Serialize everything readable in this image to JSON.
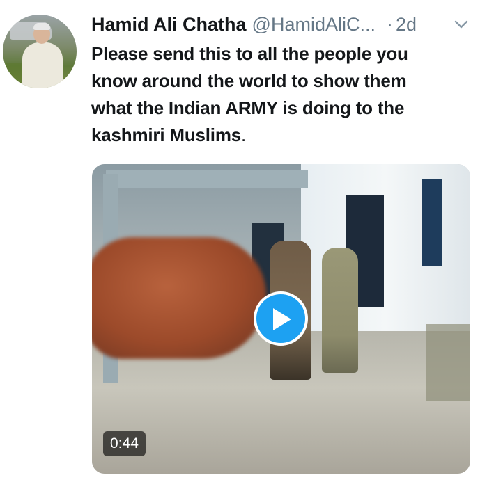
{
  "tweet": {
    "author_name": "Hamid Ali Chatha",
    "author_handle": "@HamidAliC...",
    "separator": "·",
    "timestamp": "2d",
    "text_lines": [
      "Please send this to all the people you",
      "know around the world to show them",
      "what the Indian ARMY is doing to the",
      "kashmiri Muslims"
    ],
    "text_period": "."
  },
  "media": {
    "type": "video",
    "duration": "0:44",
    "play_icon": "play-icon"
  },
  "icons": {
    "menu": "chevron-down-icon",
    "avatar": "avatar"
  },
  "colors": {
    "accent": "#1da1f2",
    "text": "#14171a",
    "secondary_text": "#657786"
  }
}
